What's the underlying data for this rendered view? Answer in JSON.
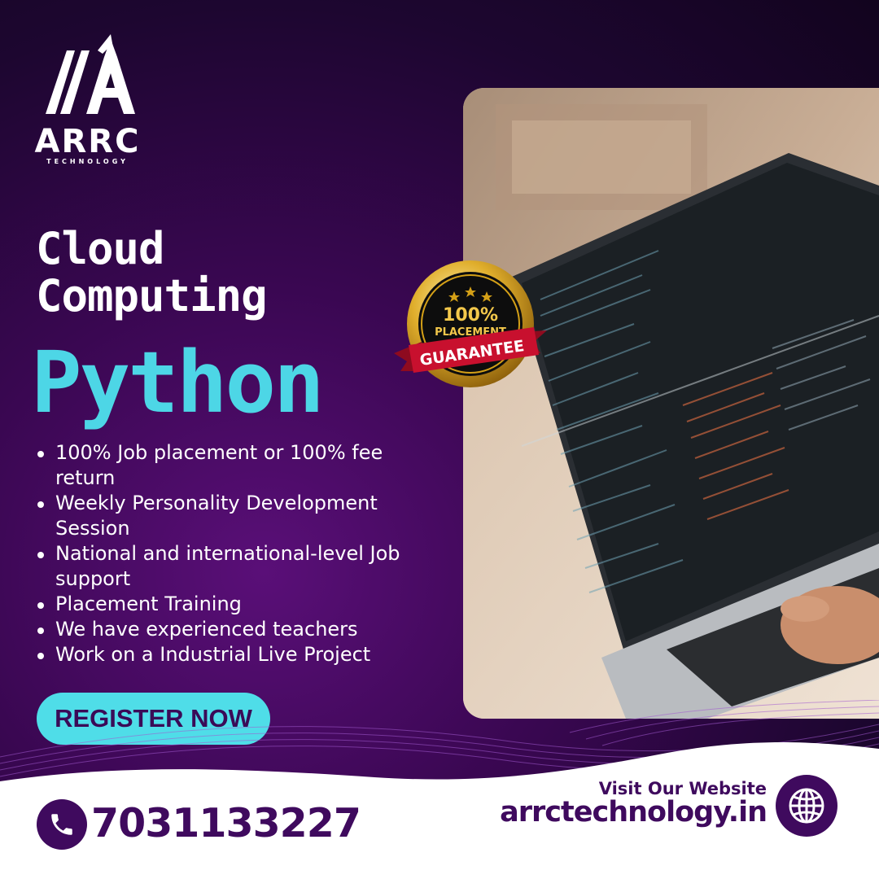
{
  "logo": {
    "brand": "ARRC",
    "tagline": "TECHNOLOGY"
  },
  "headline": {
    "line1": "Cloud",
    "line2": "Computing"
  },
  "course": "Python",
  "features": [
    "100% Job placement or 100% fee return",
    "Weekly Personality Development Session",
    "National and international-level Job support",
    "Placement Training",
    "We have experienced teachers",
    "Work on a Industrial Live Project"
  ],
  "cta": {
    "label": "REGISTER NOW"
  },
  "badge": {
    "line1": "100%",
    "line2": "PLACEMENT",
    "ribbon": "GUARANTEE"
  },
  "contact": {
    "phone": "7031133227",
    "visit_label": "Visit Our Website",
    "website": "arrctechnology.in"
  },
  "icons": {
    "phone": "phone-icon",
    "globe": "globe-icon",
    "stars": "star-icon"
  },
  "colors": {
    "background": "#2a0840",
    "accent": "#4dd6e6",
    "brand_purple": "#3f0a5e",
    "ribbon_red": "#c8102e",
    "gold": "#d4a017"
  }
}
